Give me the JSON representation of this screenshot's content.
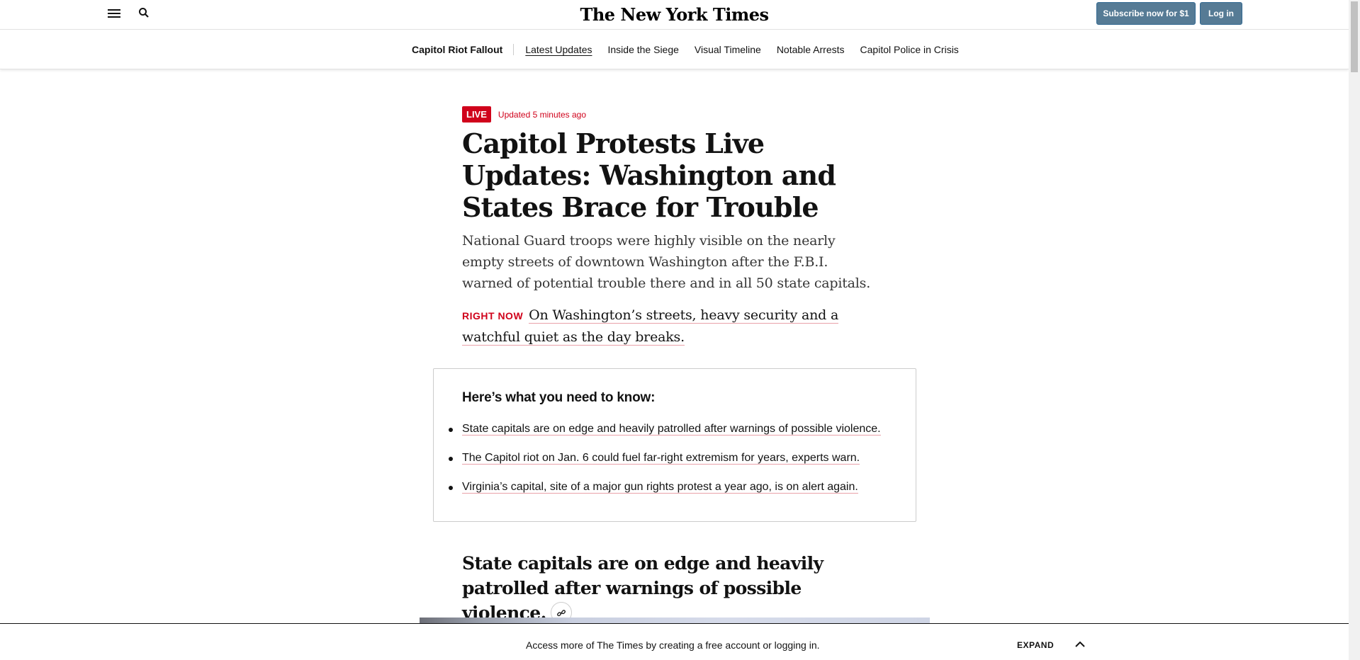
{
  "masthead": {
    "logo": "The New York Times",
    "subscribe_label": "Subscribe now for $1",
    "login_label": "Log in",
    "menu_icon": "hamburger-icon",
    "search_icon": "search-icon"
  },
  "section_nav": {
    "title": "Capitol Riot Fallout",
    "links": [
      "Latest Updates",
      "Inside the Siege",
      "Visual Timeline",
      "Notable Arrests",
      "Capitol Police in Crisis"
    ],
    "active_index": 0
  },
  "article": {
    "live_label": "LIVE",
    "updated": "Updated 5 minutes ago",
    "headline": "Capitol Protests Live Updates: Washington and States Brace for Trouble",
    "summary": "National Guard troops were highly visible on the nearly empty streets of downtown Washington after the F.B.I. warned of potential trouble there and in all 50 state capitals.",
    "right_now_label": "RIGHT NOW",
    "right_now_text": "On Washington’s streets, heavy security and a watchful quiet as the day breaks."
  },
  "need_to_know": {
    "title": "Here’s what you need to know:",
    "items": [
      "State capitals are on edge and heavily patrolled after warnings of possible violence.",
      "The Capitol riot on Jan. 6 could fuel far-right extremism for years, experts warn.",
      "Virginia’s capital, site of a major gun rights protest a year ago, is on alert again."
    ]
  },
  "sub_headline": "State capitals are on edge and heavily patrolled after warnings of possible violence.",
  "bottom_bar": {
    "text": "Access more of The Times by creating a free account or logging in.",
    "expand_label": "EXPAND",
    "chevron_icon": "chevron-up-icon"
  },
  "colors": {
    "live_red": "#d0021b",
    "button_blue": "#567b95"
  }
}
